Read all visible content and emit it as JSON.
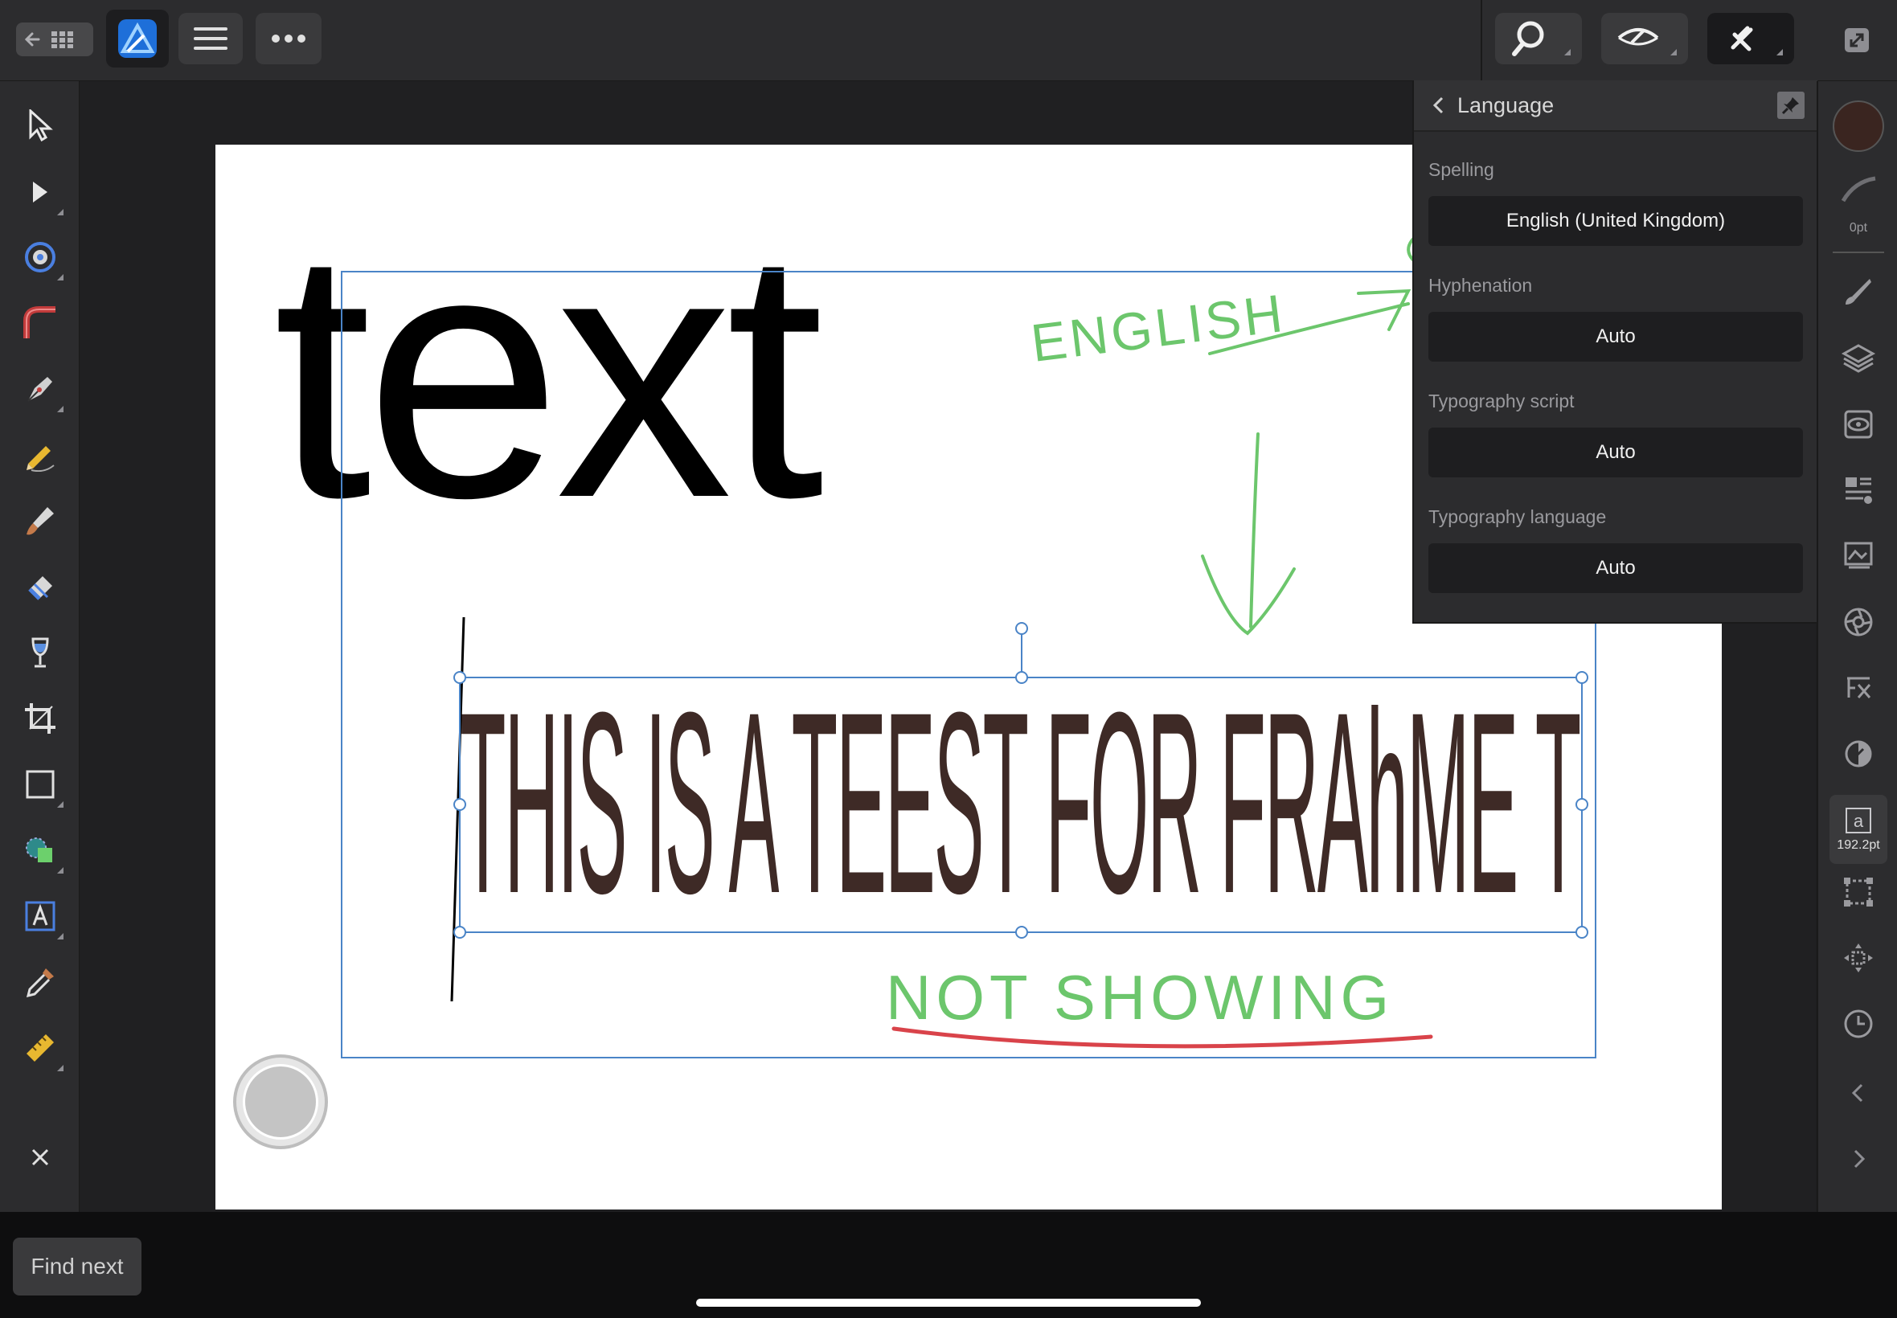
{
  "app": {
    "name": "Affinity Designer"
  },
  "panel": {
    "title": "Language",
    "spelling_label": "Spelling",
    "spelling_value": "English (United Kingdom)",
    "hyphenation_label": "Hyphenation",
    "hyphenation_value": "Auto",
    "typo_script_label": "Typography script",
    "typo_script_value": "Auto",
    "typo_language_label": "Typography language",
    "typo_language_value": "Auto"
  },
  "studio": {
    "stroke_width": "0pt",
    "font_size": "192.2pt"
  },
  "canvas": {
    "art_text": "text",
    "frame_text": "THIS  IS  A  TEEST  FOR  FRAhME  TEXT",
    "annotation_english": "ENGLISH",
    "annotation_not_showing": "NOT SHOWING"
  },
  "bottom": {
    "find_next": "Find next"
  },
  "colors": {
    "fill_swatch": "#3a2520",
    "annotation_green": "#6cc66c",
    "annotation_red": "#d9434a",
    "frame_text_color": "#3e2a26",
    "selection_blue": "#4a84c7"
  }
}
